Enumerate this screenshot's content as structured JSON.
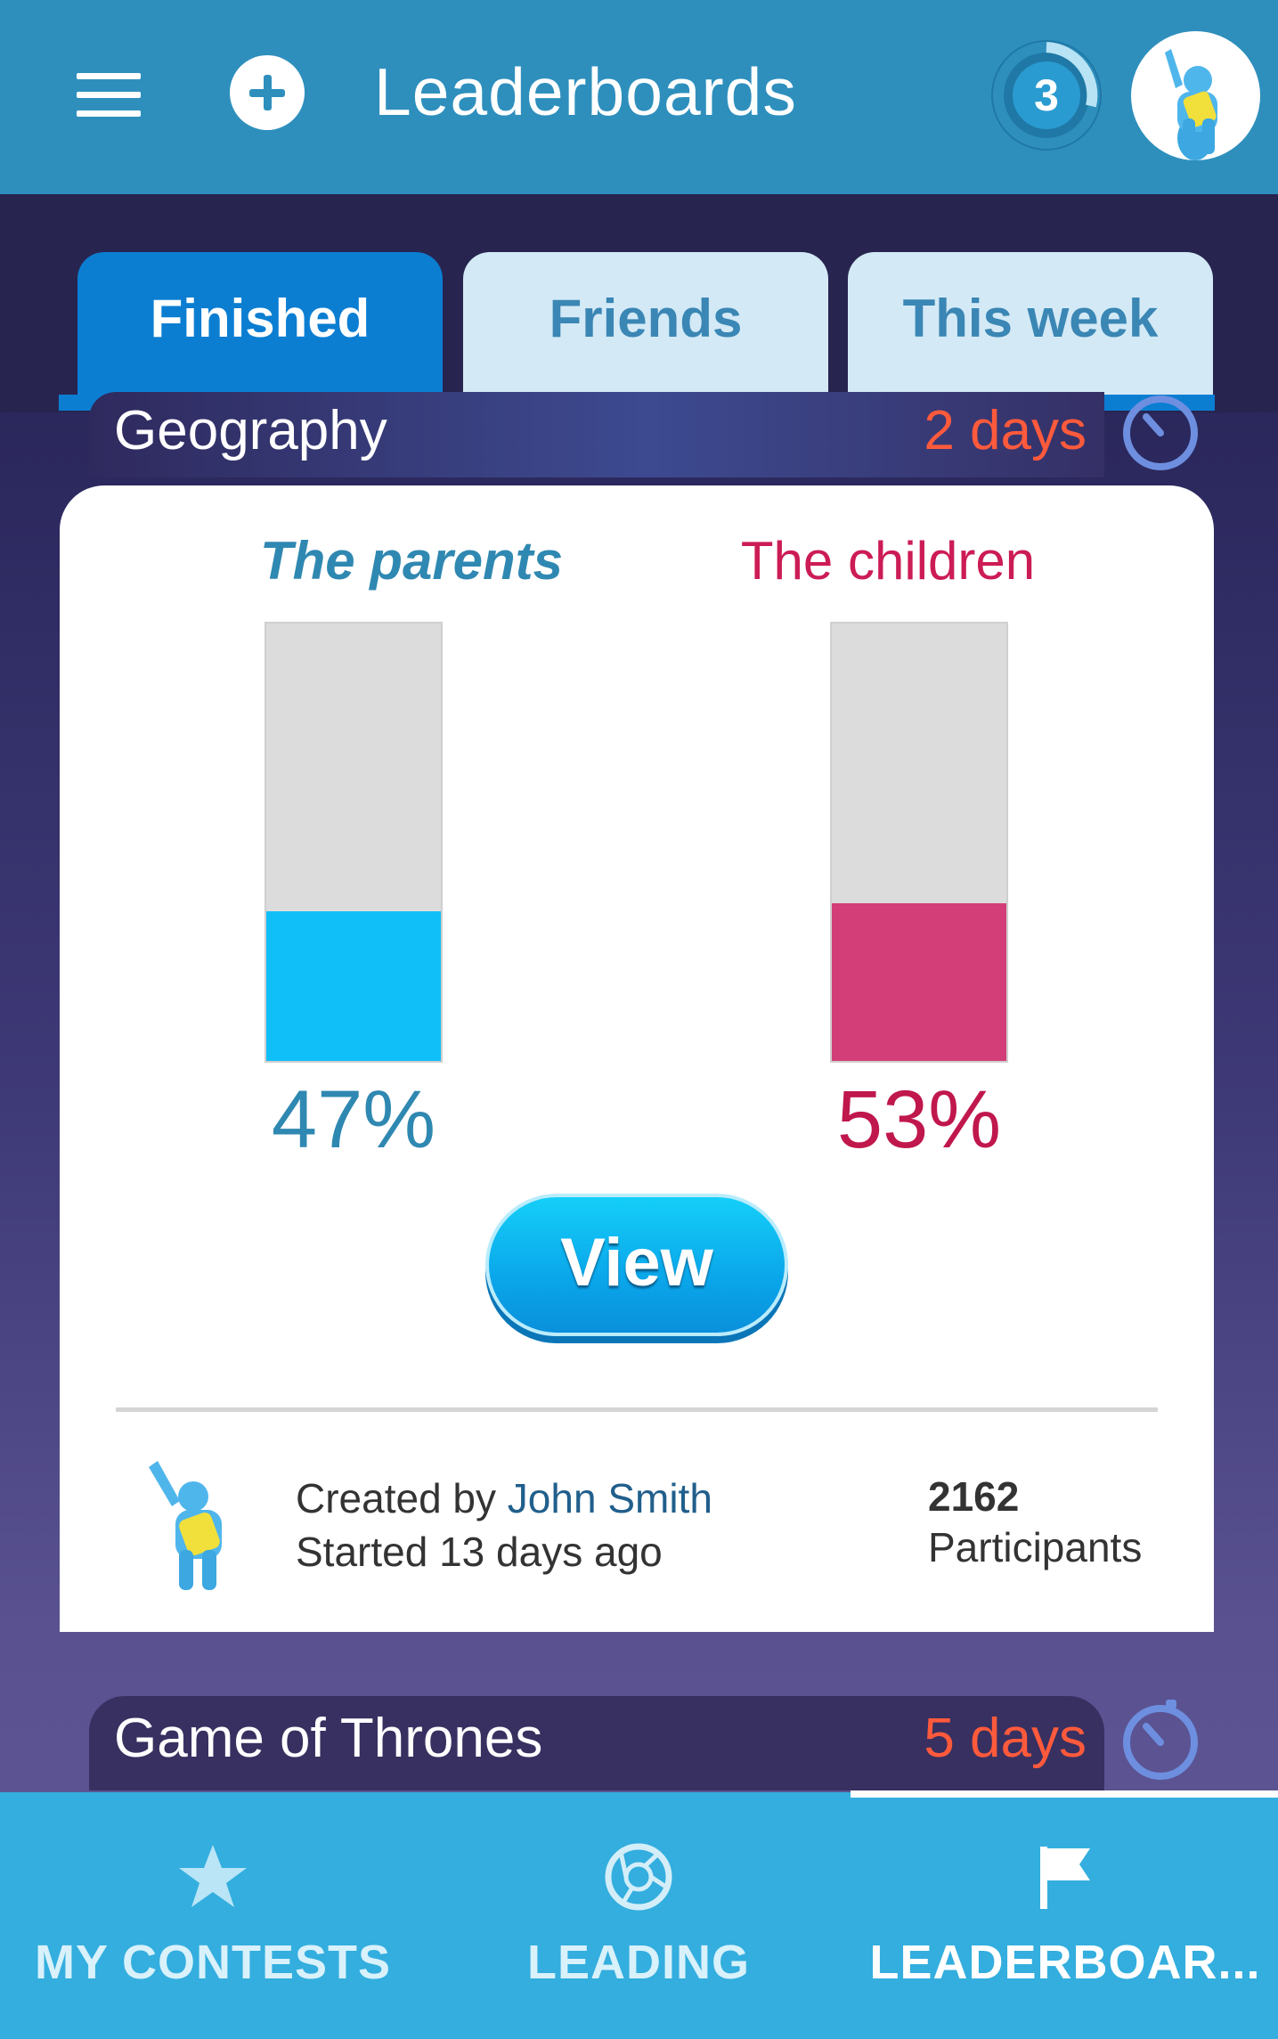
{
  "header": {
    "title": "Leaderboards",
    "level": "3",
    "menu_icon": "menu-icon",
    "add_icon": "add-circle-icon"
  },
  "tabs": [
    {
      "label": "Finished",
      "active": true
    },
    {
      "label": "Friends",
      "active": false
    },
    {
      "label": "This week",
      "active": false
    }
  ],
  "contests": [
    {
      "title": "Geography",
      "remaining": "2 days",
      "team_a": {
        "name": "The parents",
        "percent_label": "47%",
        "percent": 47
      },
      "team_b": {
        "name": "The children",
        "percent_label": "53%",
        "percent": 53
      },
      "view_label": "View",
      "created_prefix": "Created by",
      "creator": "John Smith",
      "started": "Started 13 days ago",
      "participants_count": "2162",
      "participants_label": "Participants"
    },
    {
      "title": "Game of Thrones",
      "remaining": "5 days"
    }
  ],
  "bottom_nav": [
    {
      "label": "MY CONTESTS",
      "icon": "star-icon",
      "active": false
    },
    {
      "label": "LEADING",
      "icon": "aperture-icon",
      "active": false
    },
    {
      "label": "LEADERBOAR...",
      "icon": "flag-icon",
      "active": true
    }
  ],
  "colors": {
    "appbar": "#2e8fbd",
    "tab_active": "#0b7ed2",
    "team_a": "#2f88b1",
    "team_b": "#cc1c55",
    "days": "#ff5a3c",
    "nav": "#33aede"
  }
}
